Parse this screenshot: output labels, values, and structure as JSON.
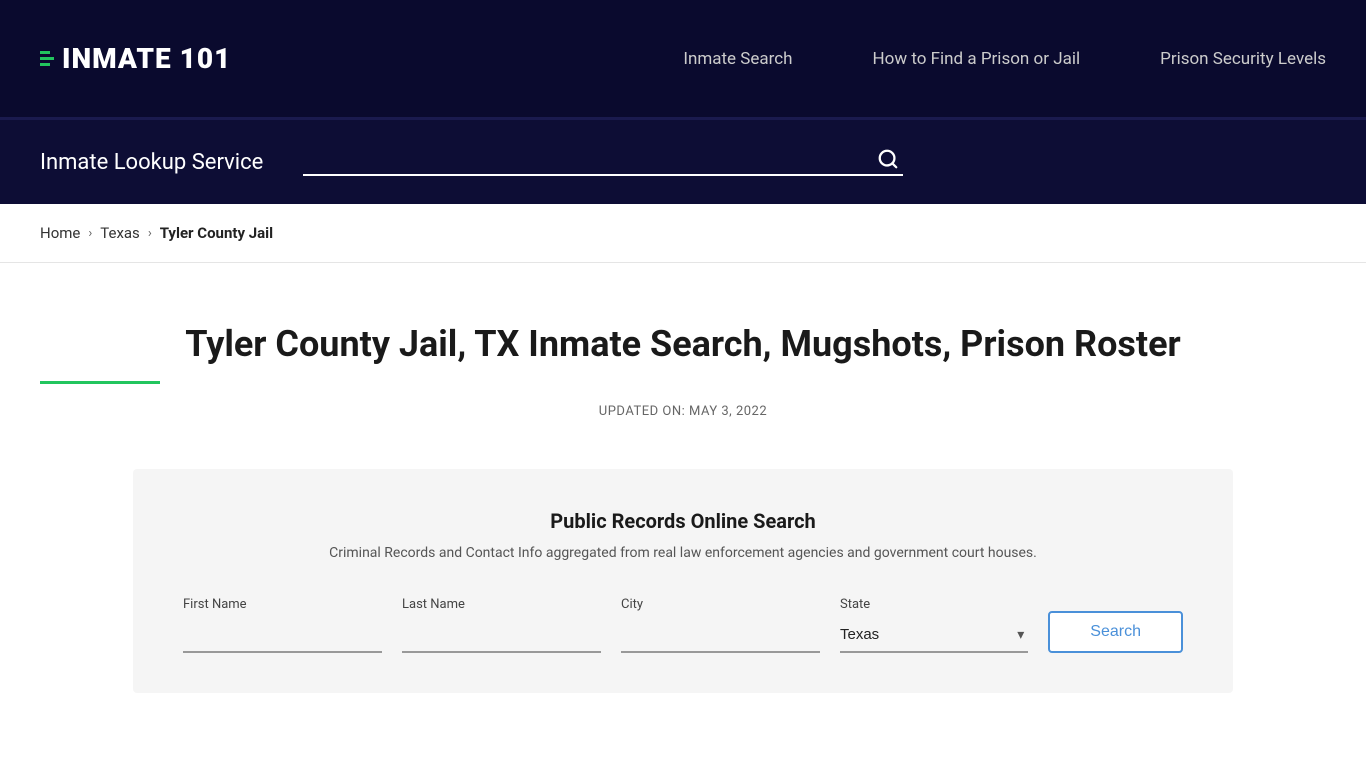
{
  "nav": {
    "logo_text": "INMATE 101",
    "logo_highlight": "101",
    "links": [
      {
        "label": "Inmate Search",
        "id": "inmate-search-link"
      },
      {
        "label": "How to Find a Prison or Jail",
        "id": "how-to-find-link"
      },
      {
        "label": "Prison Security Levels",
        "id": "security-levels-link"
      }
    ]
  },
  "search_section": {
    "label": "Inmate Lookup Service",
    "placeholder": ""
  },
  "breadcrumb": {
    "home": "Home",
    "state": "Texas",
    "current": "Tyler County Jail"
  },
  "main": {
    "title": "Tyler County Jail, TX Inmate Search, Mugshots, Prison Roster",
    "updated_label": "UPDATED ON: MAY 3, 2022"
  },
  "search_card": {
    "title": "Public Records Online Search",
    "subtitle": "Criminal Records and Contact Info aggregated from real law enforcement agencies and government court houses.",
    "form": {
      "first_name_label": "First Name",
      "last_name_label": "Last Name",
      "city_label": "City",
      "state_label": "State",
      "state_default": "Texas",
      "search_button": "Search"
    }
  }
}
